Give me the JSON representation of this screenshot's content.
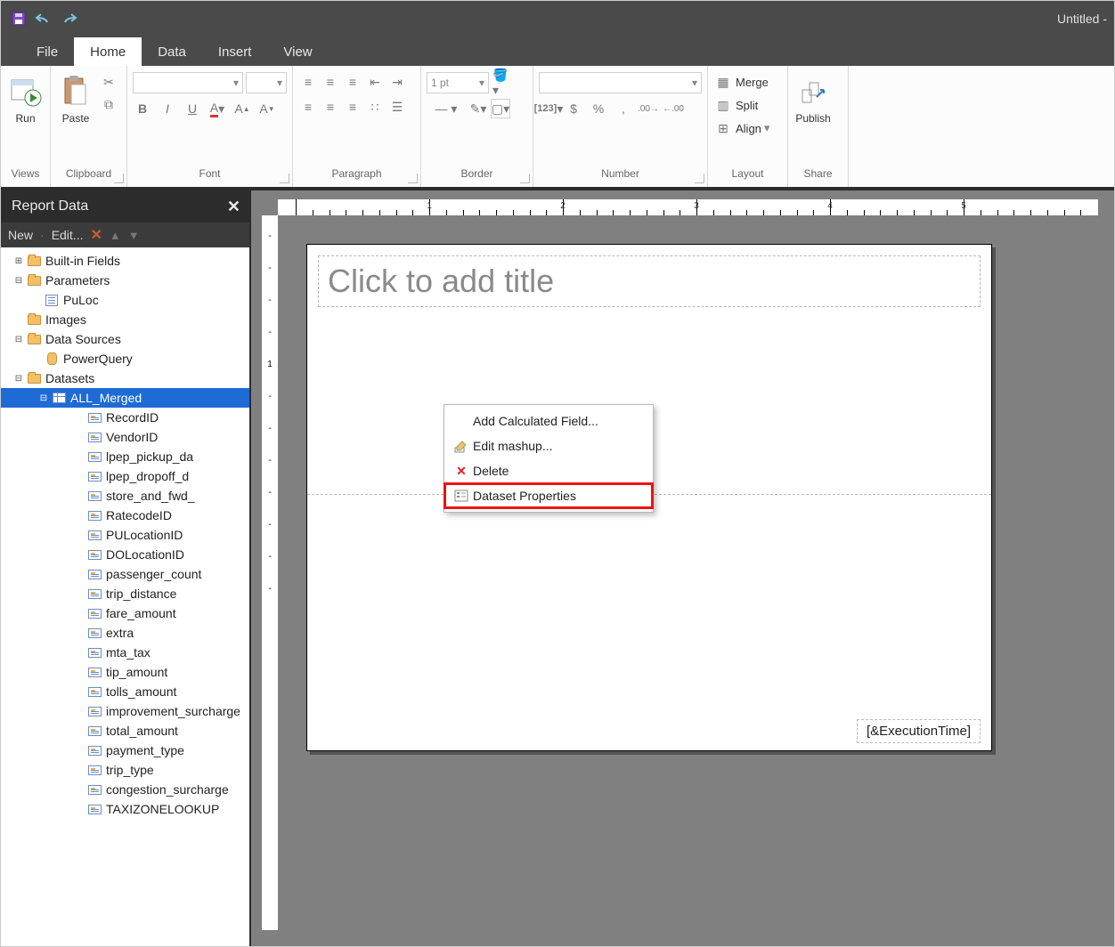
{
  "window": {
    "title": "Untitled -"
  },
  "qat": {
    "save": "Save",
    "undo": "Undo",
    "redo": "Redo"
  },
  "tabs": [
    "File",
    "Home",
    "Data",
    "Insert",
    "View"
  ],
  "active_tab": 1,
  "ribbon": {
    "views": {
      "label": "Views",
      "run": "Run"
    },
    "clipboard": {
      "label": "Clipboard",
      "paste": "Paste"
    },
    "font": {
      "label": "Font"
    },
    "paragraph": {
      "label": "Paragraph"
    },
    "border": {
      "label": "Border",
      "weight": "1 pt"
    },
    "number": {
      "label": "Number"
    },
    "layout": {
      "label": "Layout",
      "merge": "Merge",
      "split": "Split",
      "align": "Align"
    },
    "share": {
      "label": "Share",
      "publish": "Publish"
    }
  },
  "pane": {
    "title": "Report Data",
    "new": "New",
    "edit": "Edit...",
    "tree": [
      {
        "l": 0,
        "exp": "⊞",
        "ico": "fold",
        "t": "Built-in Fields"
      },
      {
        "l": 0,
        "exp": "⊟",
        "ico": "fold",
        "t": "Parameters"
      },
      {
        "l": 1,
        "exp": "",
        "ico": "parm",
        "t": "PuLoc"
      },
      {
        "l": 0,
        "exp": "",
        "ico": "fold",
        "t": "Images"
      },
      {
        "l": 0,
        "exp": "⊟",
        "ico": "fold",
        "t": "Data Sources"
      },
      {
        "l": 1,
        "exp": "",
        "ico": "cyl",
        "t": "PowerQuery"
      },
      {
        "l": 0,
        "exp": "⊟",
        "ico": "fold",
        "t": "Datasets"
      },
      {
        "l": 2,
        "exp": "⊟",
        "ico": "grid",
        "t": "ALL_Merged",
        "sel": true
      },
      {
        "l": 3,
        "ico": "fld",
        "t": "RecordID"
      },
      {
        "l": 3,
        "ico": "fld",
        "t": "VendorID"
      },
      {
        "l": 3,
        "ico": "fld",
        "t": "lpep_pickup_da"
      },
      {
        "l": 3,
        "ico": "fld",
        "t": "lpep_dropoff_d"
      },
      {
        "l": 3,
        "ico": "fld",
        "t": "store_and_fwd_"
      },
      {
        "l": 3,
        "ico": "fld",
        "t": "RatecodeID"
      },
      {
        "l": 3,
        "ico": "fld",
        "t": "PULocationID"
      },
      {
        "l": 3,
        "ico": "fld",
        "t": "DOLocationID"
      },
      {
        "l": 3,
        "ico": "fld",
        "t": "passenger_count"
      },
      {
        "l": 3,
        "ico": "fld",
        "t": "trip_distance"
      },
      {
        "l": 3,
        "ico": "fld",
        "t": "fare_amount"
      },
      {
        "l": 3,
        "ico": "fld",
        "t": "extra"
      },
      {
        "l": 3,
        "ico": "fld",
        "t": "mta_tax"
      },
      {
        "l": 3,
        "ico": "fld",
        "t": "tip_amount"
      },
      {
        "l": 3,
        "ico": "fld",
        "t": "tolls_amount"
      },
      {
        "l": 3,
        "ico": "fld",
        "t": "improvement_surcharge"
      },
      {
        "l": 3,
        "ico": "fld",
        "t": "total_amount"
      },
      {
        "l": 3,
        "ico": "fld",
        "t": "payment_type"
      },
      {
        "l": 3,
        "ico": "fld",
        "t": "trip_type"
      },
      {
        "l": 3,
        "ico": "fld",
        "t": "congestion_surcharge"
      },
      {
        "l": 3,
        "ico": "fld",
        "t": "TAXIZONELOOKUP"
      }
    ]
  },
  "context_menu": [
    {
      "label": "Add Calculated Field...",
      "icon": ""
    },
    {
      "label": "Edit mashup...",
      "icon": "edit"
    },
    {
      "label": "Delete",
      "icon": "del"
    },
    {
      "label": "Dataset Properties",
      "icon": "prop",
      "highlight": true
    }
  ],
  "canvas": {
    "title_placeholder": "Click to add title",
    "footer": "[&ExecutionTime]",
    "ruler_majors": [
      1,
      2,
      3,
      4,
      5
    ],
    "vruler": [
      1
    ]
  }
}
